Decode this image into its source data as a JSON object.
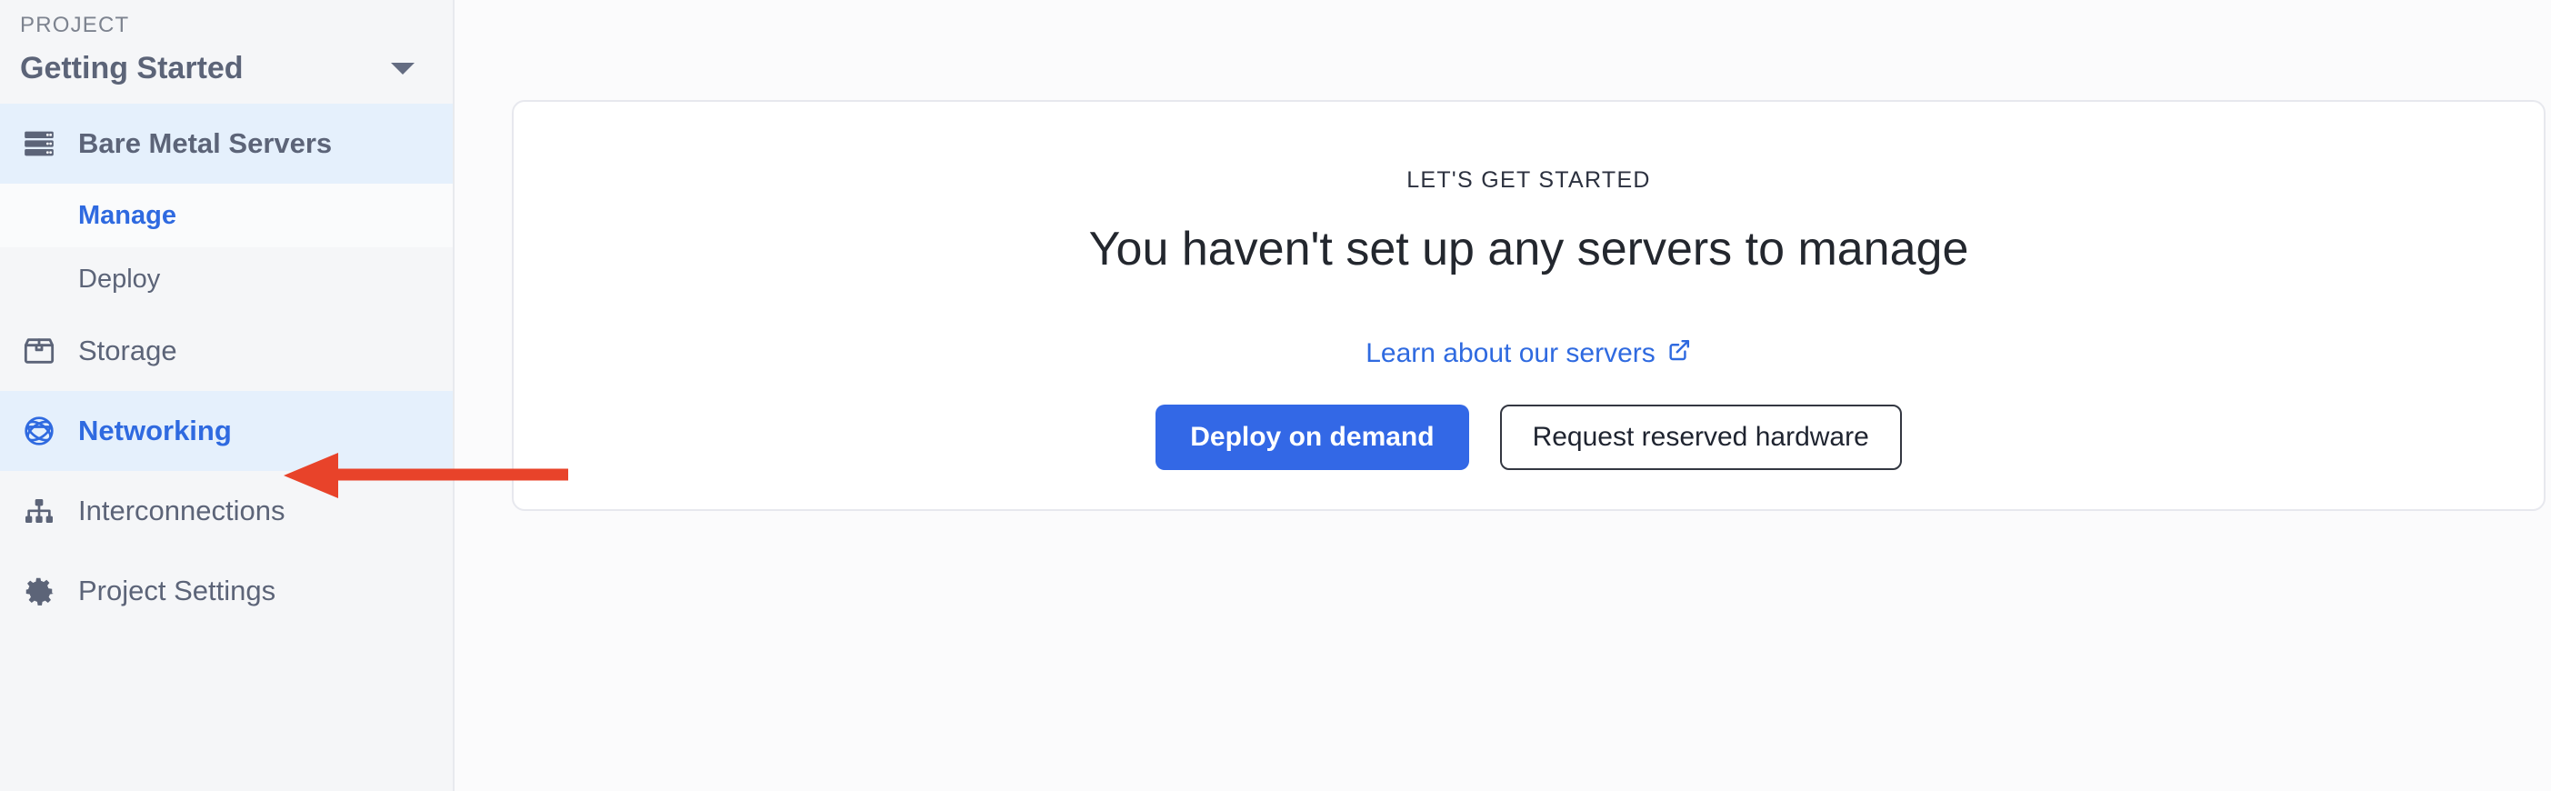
{
  "sidebar": {
    "section_label": "PROJECT",
    "project_name": "Getting Started",
    "switcher_icon": "chevron-down-icon",
    "items": [
      {
        "label": "Bare Metal Servers",
        "icon": "server-icon",
        "active": true,
        "children": [
          {
            "label": "Manage",
            "current": true
          },
          {
            "label": "Deploy",
            "current": false
          }
        ]
      },
      {
        "label": "Storage",
        "icon": "box-icon",
        "active": false
      },
      {
        "label": "Networking",
        "icon": "globe-icon",
        "active": true
      },
      {
        "label": "Interconnections",
        "icon": "hierarchy-icon",
        "active": false
      },
      {
        "label": "Project Settings",
        "icon": "gear-icon",
        "active": false
      }
    ]
  },
  "main": {
    "eyebrow": "LET'S GET STARTED",
    "headline": "You haven't set up any servers to manage",
    "learn_link": {
      "label": "Learn about our servers",
      "icon": "external-link-icon"
    },
    "primary_button": "Deploy on demand",
    "secondary_button": "Request reserved hardware"
  },
  "annotation": {
    "type": "arrow",
    "points_to": "Networking",
    "color": "#e8432a"
  },
  "colors": {
    "accent_blue": "#2f6ae0",
    "button_blue": "#3368e6",
    "active_row_bg": "#e5f0fc",
    "sidebar_bg": "#f5f6f8",
    "canvas_bg": "#fbfbfc",
    "text_muted": "#5c6478",
    "annotation_red": "#e8432a"
  }
}
